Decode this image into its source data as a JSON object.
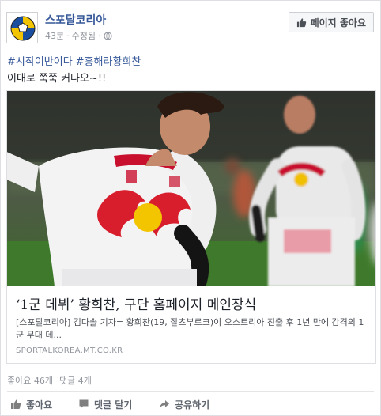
{
  "header": {
    "page_name": "스포탈코리아",
    "time": "43분",
    "separator": "·",
    "edited": "수정됨",
    "separator2": "·",
    "like_page_button": "페이지 좋아요"
  },
  "post": {
    "hashtags": [
      "#시작이반이다",
      "#흥해라황희찬"
    ],
    "text": "이대로 쭉쭉 커다오~!!"
  },
  "link": {
    "title": "‘1군 데뷔’ 황희찬, 구단 홈페이지 메인장식",
    "description": "[스포탈코리아] 김다솔 기자= 황희찬(19, 잘츠부르크)이 오스트리아 진출 후 1년 만에 감격의 1군 무대 데...",
    "domain": "SPORTALKOREA.MT.CO.KR"
  },
  "stats": {
    "likes": "좋아요 46개",
    "comments": "댓글 4개"
  },
  "actions": {
    "like": "좋아요",
    "comment": "댓글 달기",
    "share": "공유하기"
  },
  "colors": {
    "link_blue": "#365899",
    "meta_gray": "#90949c",
    "border": "#dddfe2"
  },
  "icons": [
    "soccer-ball-avatar",
    "globe-icon",
    "thumbs-up-icon",
    "comment-icon",
    "share-icon"
  ]
}
